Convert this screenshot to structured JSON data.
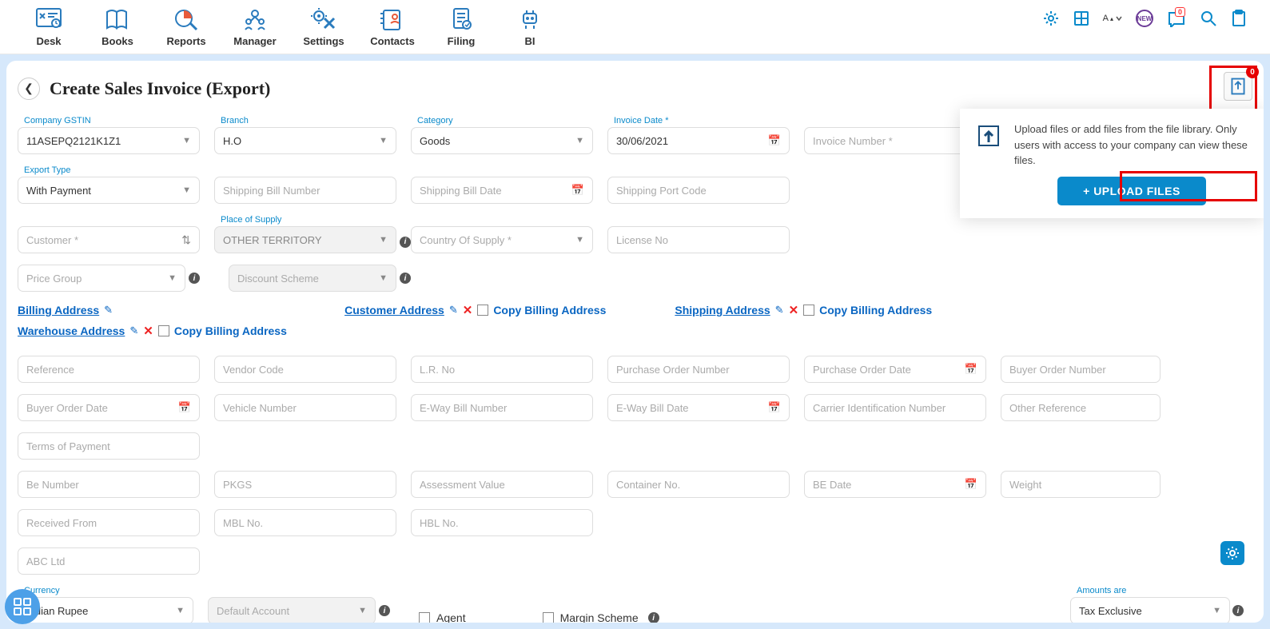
{
  "nav": {
    "items": [
      {
        "label": "Desk"
      },
      {
        "label": "Books"
      },
      {
        "label": "Reports"
      },
      {
        "label": "Manager"
      },
      {
        "label": "Settings"
      },
      {
        "label": "Contacts"
      },
      {
        "label": "Filing"
      },
      {
        "label": "BI"
      }
    ],
    "font_toggle": "A",
    "new_badge": "NEW",
    "notif_count": "0"
  },
  "page": {
    "title": "Create Sales Invoice (Export)",
    "doc_badge": "0"
  },
  "form": {
    "company_gstin": {
      "label": "Company GSTIN",
      "value": "11ASEPQ2121K1Z1"
    },
    "branch": {
      "label": "Branch",
      "value": "H.O"
    },
    "category": {
      "label": "Category",
      "value": "Goods"
    },
    "invoice_date": {
      "label": "Invoice Date *",
      "value": "30/06/2021"
    },
    "invoice_number": {
      "placeholder": "Invoice Number *"
    },
    "export_type": {
      "label": "Export Type",
      "value": "With Payment"
    },
    "shipping_bill_number": {
      "placeholder": "Shipping Bill Number"
    },
    "shipping_bill_date": {
      "placeholder": "Shipping Bill Date"
    },
    "shipping_port_code": {
      "placeholder": "Shipping Port Code"
    },
    "customer": {
      "placeholder": "Customer *"
    },
    "place_of_supply": {
      "label": "Place of Supply",
      "value": "OTHER TERRITORY"
    },
    "country_of_supply": {
      "placeholder": "Country Of Supply *"
    },
    "license_no": {
      "placeholder": "License No"
    },
    "price_group": {
      "placeholder": "Price Group"
    },
    "discount_scheme": {
      "placeholder": "Discount Scheme"
    },
    "reference": {
      "placeholder": "Reference"
    },
    "vendor_code": {
      "placeholder": "Vendor Code"
    },
    "lr_no": {
      "placeholder": "L.R. No"
    },
    "purchase_order_number": {
      "placeholder": "Purchase Order Number"
    },
    "purchase_order_date": {
      "placeholder": "Purchase Order Date"
    },
    "buyer_order_number": {
      "placeholder": "Buyer Order Number"
    },
    "buyer_order_date": {
      "placeholder": "Buyer Order Date"
    },
    "vehicle_number": {
      "placeholder": "Vehicle Number"
    },
    "eway_bill_number": {
      "placeholder": "E-Way Bill Number"
    },
    "eway_bill_date": {
      "placeholder": "E-Way Bill Date"
    },
    "carrier_id": {
      "placeholder": "Carrier Identification Number"
    },
    "other_reference": {
      "placeholder": "Other Reference"
    },
    "terms_of_payment": {
      "placeholder": "Terms of Payment"
    },
    "be_number": {
      "placeholder": "Be Number"
    },
    "pkgs": {
      "placeholder": "PKGS"
    },
    "assessment_value": {
      "placeholder": "Assessment Value"
    },
    "container_no": {
      "placeholder": "Container No."
    },
    "be_date": {
      "placeholder": "BE Date"
    },
    "weight": {
      "placeholder": "Weight"
    },
    "received_from": {
      "placeholder": "Received From"
    },
    "mbl_no": {
      "placeholder": "MBL No."
    },
    "hbl_no": {
      "placeholder": "HBL No."
    },
    "abc_ltd": {
      "placeholder": "ABC Ltd"
    },
    "currency": {
      "label": "Currency",
      "value": "Indian Rupee"
    },
    "default_account": {
      "placeholder": "Default Account"
    },
    "agent": {
      "label": "Agent"
    },
    "margin_scheme": {
      "label": "Margin Scheme"
    },
    "amounts_are": {
      "label": "Amounts are",
      "value": "Tax Exclusive"
    }
  },
  "addr": {
    "billing": "Billing Address",
    "customer": "Customer Address",
    "shipping": "Shipping Address",
    "warehouse": "Warehouse Address",
    "copy": "Copy Billing Address"
  },
  "upload": {
    "text": "Upload files or add files from the file library. Only users with access to your company can view these files.",
    "button": "+ UPLOAD FILES"
  }
}
